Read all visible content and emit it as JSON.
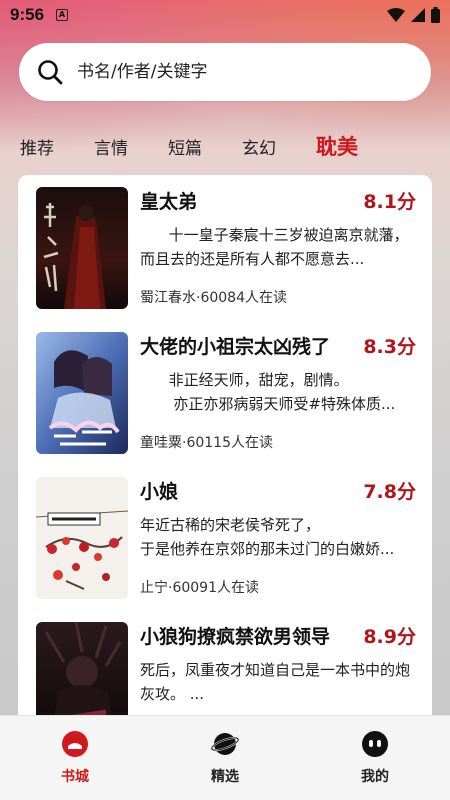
{
  "status_bar": {
    "time": "9:56",
    "notification_glyph": "A"
  },
  "search": {
    "placeholder": "书名/作者/关键字"
  },
  "tabs": [
    {
      "label": "推荐",
      "active": false
    },
    {
      "label": "言情",
      "active": false
    },
    {
      "label": "短篇",
      "active": false
    },
    {
      "label": "玄幻",
      "active": false
    },
    {
      "label": "耽美",
      "active": true
    }
  ],
  "books": [
    {
      "title": "皇太弟",
      "score": "8.1分",
      "desc": "      十一皇子秦宸十三岁被迫离京就藩，而且去的还是所有人都不愿意去...",
      "meta": "蜀江春水·60084人在读"
    },
    {
      "title": "大佬的小祖宗太凶残了",
      "score": "8.3分",
      "desc": "      非正经天师，甜宠，剧情。\n       亦正亦邪病弱天师受#特殊体质...",
      "meta": "童哇粟·60115人在读"
    },
    {
      "title": "小娘",
      "score": "7.8分",
      "desc": "年近古稀的宋老侯爷死了，\n于是他养在京郊的那未过门的白嫩娇...",
      "meta": "止宁·60091人在读"
    },
    {
      "title": "小狼狗撩疯禁欲男领导",
      "score": "8.9分",
      "desc": "死后，凤重夜才知道自己是一本书中的炮灰攻。 ...",
      "meta": ""
    }
  ],
  "bottom_nav": [
    {
      "label": "书城",
      "icon": "bookstore-icon",
      "active": true
    },
    {
      "label": "精选",
      "icon": "planet-icon",
      "active": false
    },
    {
      "label": "我的",
      "icon": "profile-icon",
      "active": false
    }
  ],
  "colors": {
    "accent": "#d0191d",
    "score": "#b3141a"
  }
}
